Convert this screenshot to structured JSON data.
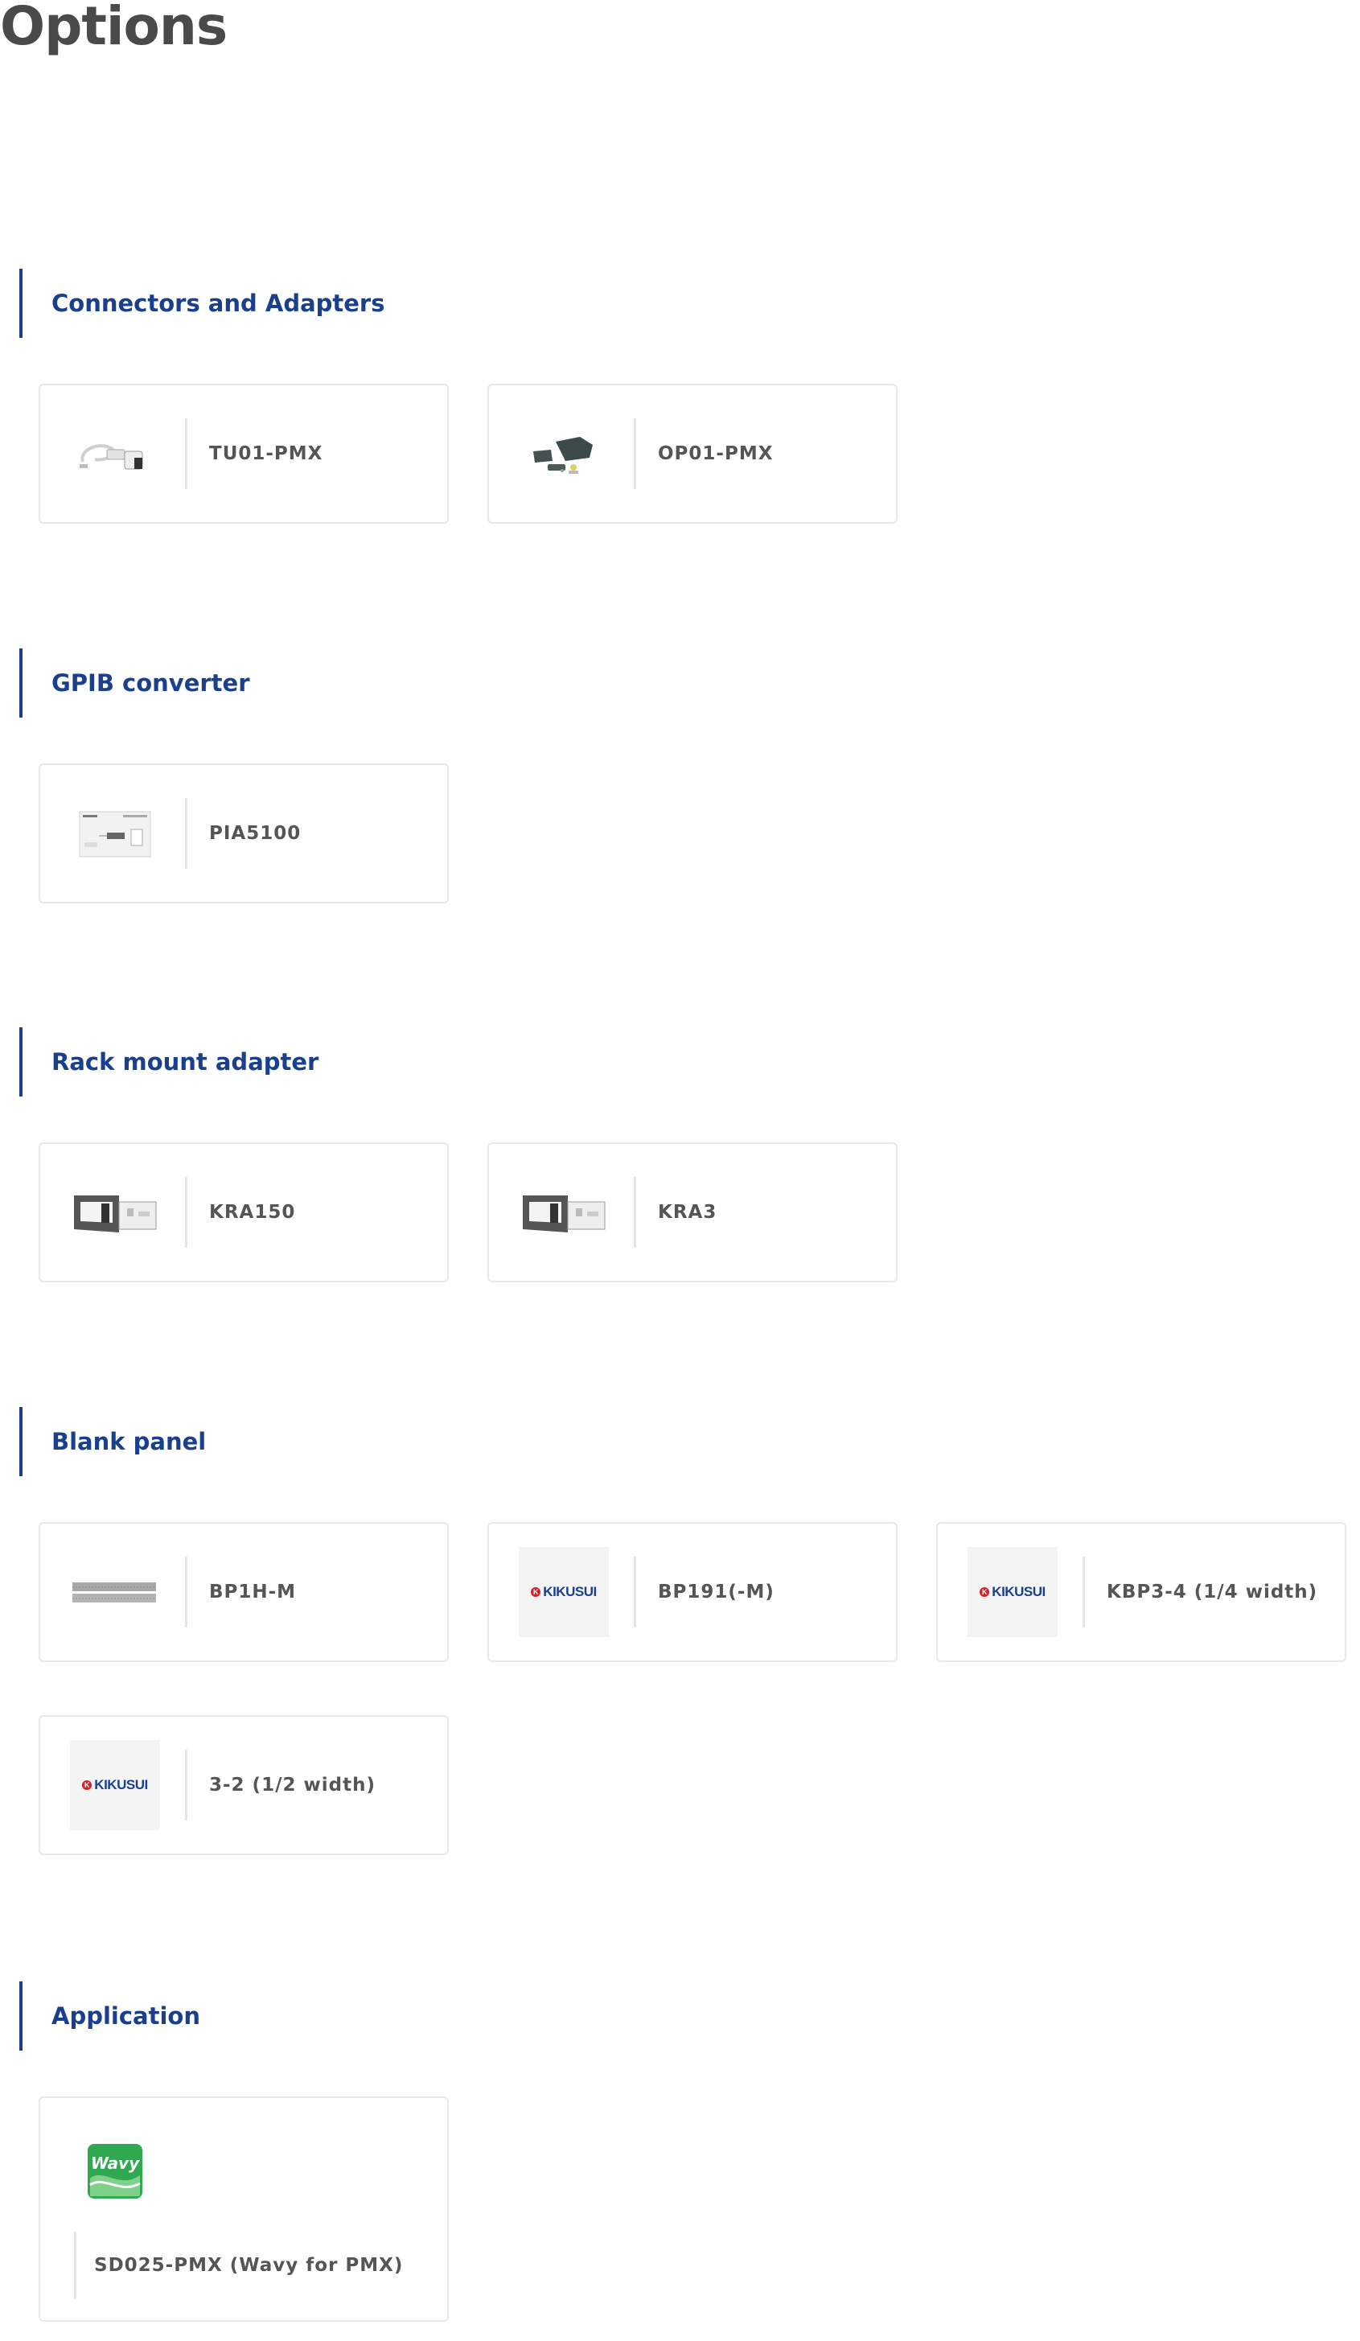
{
  "page": {
    "title": "Options"
  },
  "sections": [
    {
      "heading": "Connectors and Adapters",
      "items": [
        {
          "label": "TU01-PMX",
          "icon": "cable-adapter-icon"
        },
        {
          "label": "OP01-PMX",
          "icon": "connector-parts-icon"
        }
      ]
    },
    {
      "heading": "GPIB converter",
      "items": [
        {
          "label": "PIA5100",
          "icon": "gpib-converter-icon"
        }
      ]
    },
    {
      "heading": "Rack mount adapter",
      "items": [
        {
          "label": "KRA150",
          "icon": "rack-adapter-icon"
        },
        {
          "label": "KRA3",
          "icon": "rack-adapter-icon"
        }
      ]
    },
    {
      "heading": "Blank panel",
      "items": [
        {
          "label": "BP1H-M",
          "icon": "blank-panel-icon"
        },
        {
          "label": "BP191(-M)",
          "icon": "kikusui-logo"
        },
        {
          "label": "KBP3-4 (1/4 width)",
          "icon": "kikusui-logo"
        },
        {
          "label": "3-2 (1/2 width)",
          "icon": "kikusui-logo"
        }
      ]
    },
    {
      "heading": "Application",
      "items": [
        {
          "label": "SD025-PMX (Wavy for PMX)",
          "icon": "wavy-app-icon",
          "icon_text": "Wavy"
        }
      ]
    }
  ],
  "brand": {
    "logo_text": "KIKUSUI",
    "logo_mark": "K"
  },
  "colors": {
    "accent": "#1a3f8c",
    "section_bar": "#1e3f8f",
    "card_border": "#e8e8ea",
    "wavy_green": "#2fa84f"
  }
}
